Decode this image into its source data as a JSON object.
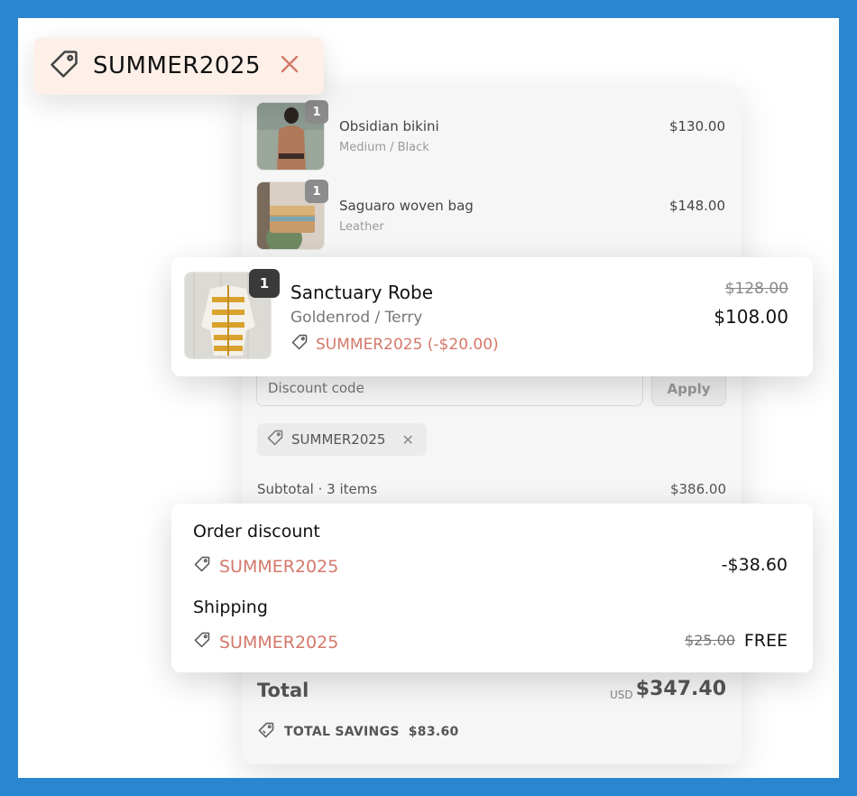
{
  "coupon": {
    "code": "SUMMER2025"
  },
  "items": [
    {
      "name": "Obsidian bikini",
      "variant": "Medium / Black",
      "price": "$130.00",
      "qty": "1"
    },
    {
      "name": "Saguaro woven bag",
      "variant": "Leather",
      "price": "$148.00",
      "qty": "1"
    }
  ],
  "highlight_item": {
    "name": "Sanctuary Robe",
    "variant": "Goldenrod / Terry",
    "discount_label": "SUMMER2025 (-$20.00)",
    "old_price": "$128.00",
    "new_price": "$108.00",
    "qty": "1"
  },
  "discount_form": {
    "placeholder": "Discount code",
    "apply_label": "Apply"
  },
  "applied_chip": {
    "code": "SUMMER2025"
  },
  "subtotal": {
    "label": "Subtotal · 3 items",
    "value": "$386.00"
  },
  "discounts": {
    "order_discount_label": "Order discount",
    "order_discount_code": "SUMMER2025",
    "order_discount_amount": "-$38.60",
    "shipping_label": "Shipping",
    "shipping_code": "SUMMER2025",
    "shipping_old": "$25.00",
    "shipping_new": "FREE"
  },
  "total": {
    "label": "Total",
    "currency": "USD",
    "value": "$347.40"
  },
  "savings": {
    "label": "TOTAL SAVINGS",
    "value": "$83.60"
  },
  "colors": {
    "accent": "#d4786a",
    "frame": "#2a86cf",
    "coupon_bg": "#fcf0e8"
  },
  "icons": [
    "tag-icon",
    "close-icon",
    "savings-tag-icon"
  ]
}
